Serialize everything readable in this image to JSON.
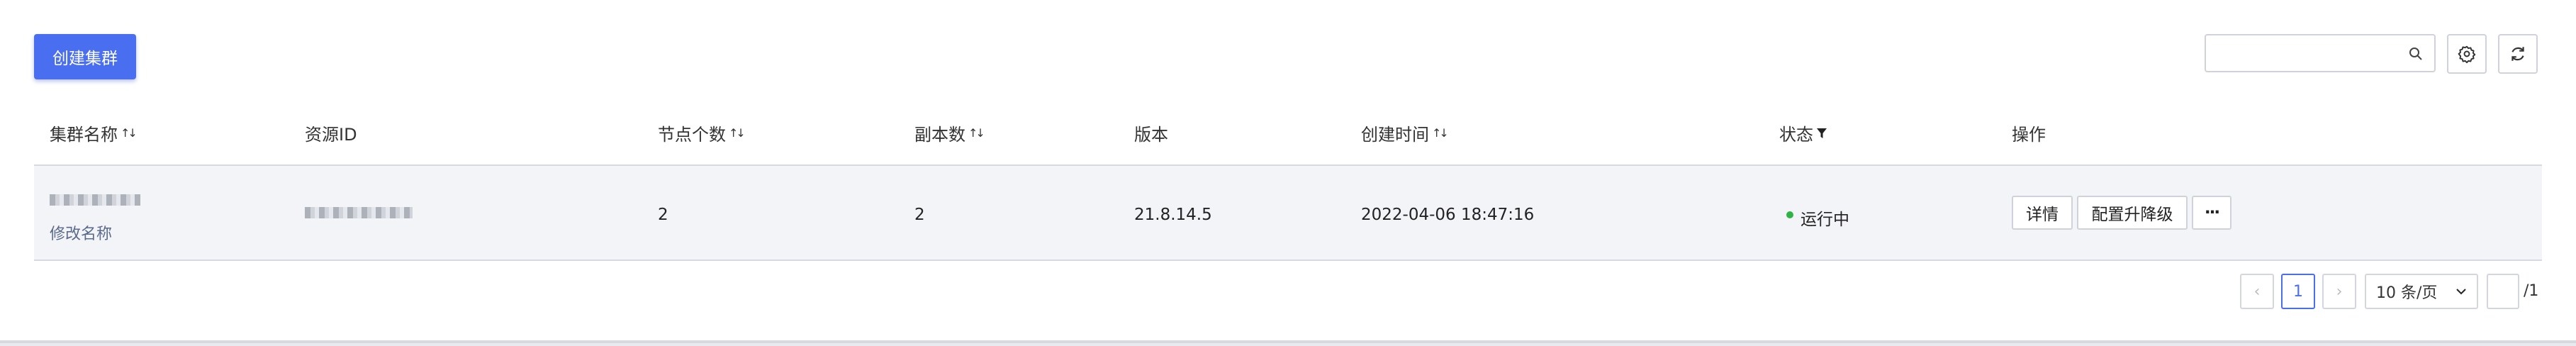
{
  "toolbar": {
    "create_label": "创建集群",
    "search_placeholder": ""
  },
  "table": {
    "headers": {
      "name": "集群名称",
      "resource_id": "资源ID",
      "nodes": "节点个数",
      "replicas": "副本数",
      "version": "版本",
      "created": "创建时间",
      "status": "状态",
      "actions": "操作"
    },
    "rows": [
      {
        "rename_link": "修改名称",
        "nodes": "2",
        "replicas": "2",
        "version": "21.8.14.5",
        "created": "2022-04-06 18:47:16",
        "status": "运行中",
        "status_color": "#2fb344",
        "actions": {
          "details": "详情",
          "upgrade": "配置升降级",
          "more": "···"
        }
      }
    ]
  },
  "pagination": {
    "prev": "‹",
    "current_page": "1",
    "next": "›",
    "page_size": "10 条/页",
    "jump_value": "",
    "total_pages": "/1"
  },
  "colors": {
    "primary": "#4a6ef0",
    "row_bg": "#f3f4f8"
  }
}
